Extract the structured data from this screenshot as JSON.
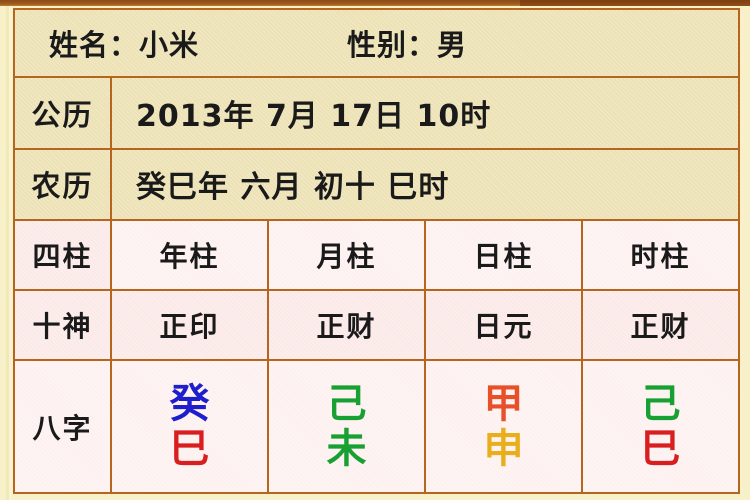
{
  "header": {
    "name_label": "姓名：小米",
    "gender_label": "性别：男"
  },
  "rows": {
    "solar": {
      "label": "公历",
      "value": "2013年 7月 17日 10时"
    },
    "lunar": {
      "label": "农历",
      "value": "癸巳年 六月 初十 巳时"
    },
    "pillars": {
      "label": "四柱",
      "year": "年柱",
      "month": "月柱",
      "day": "日柱",
      "hour": "时柱"
    },
    "ten_gods": {
      "label": "十神",
      "year": "正印",
      "month": "正财",
      "day": "日元",
      "hour": "正财"
    },
    "bazi": {
      "label": "八字",
      "year_stem": "癸",
      "year_branch": "巳",
      "month_stem": "己",
      "month_branch": "未",
      "day_stem": "甲",
      "day_branch": "申",
      "hour_stem": "己",
      "hour_branch": "巳"
    }
  },
  "colors": {
    "border": "#B5651D",
    "beige_bg": "#EDE2B6",
    "pink_bg": "#FBE9E8",
    "page_bg": "#F7F0C8",
    "top_bar": "#8E4A16",
    "water_blue": "#1E1ECC",
    "fire_red": "#D81E1E",
    "earth_green": "#19A033",
    "wood_orange": "#E8502A",
    "metal_gold": "#E8AE1B",
    "text_black": "#1A1A1A"
  }
}
